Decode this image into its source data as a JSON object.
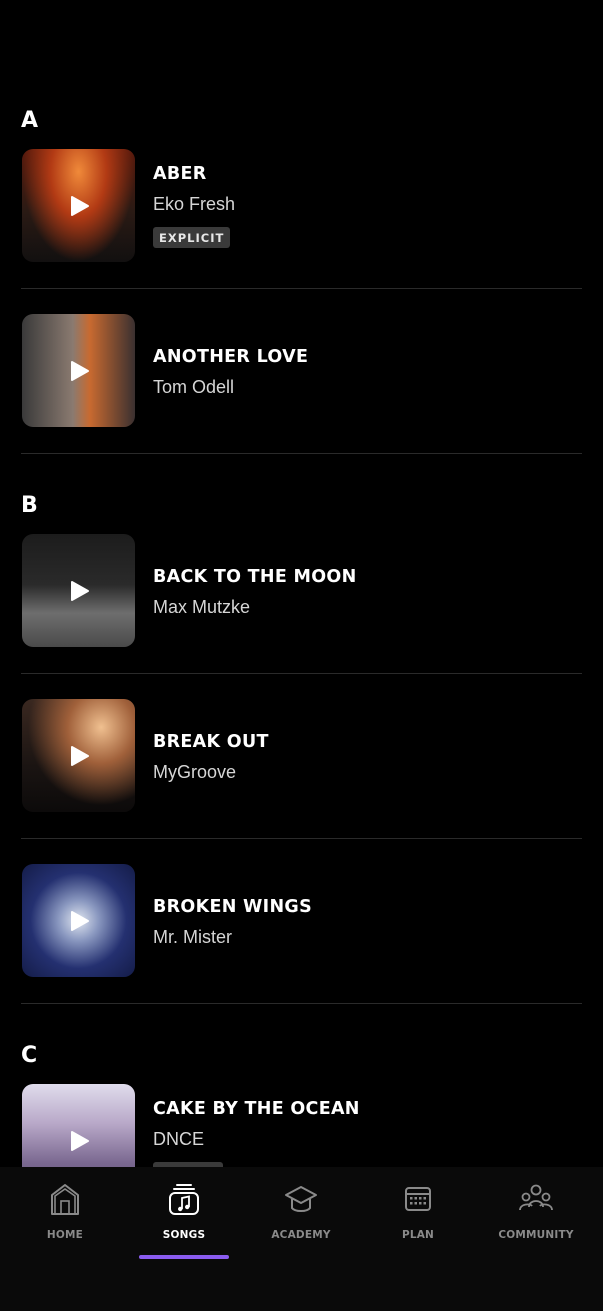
{
  "sections": [
    {
      "letter": "A"
    },
    {
      "letter": "B"
    },
    {
      "letter": "C"
    }
  ],
  "songs": [
    {
      "title": "ABER",
      "artist": "Eko Fresh",
      "badge": "EXPLICIT"
    },
    {
      "title": "ANOTHER LOVE",
      "artist": "Tom Odell"
    },
    {
      "title": "BACK TO THE MOON",
      "artist": "Max Mutzke"
    },
    {
      "title": "BREAK OUT",
      "artist": "MyGroove"
    },
    {
      "title": "BROKEN WINGS",
      "artist": "Mr. Mister"
    },
    {
      "title": "CAKE BY THE OCEAN",
      "artist": "DNCE"
    }
  ],
  "nav": {
    "home": "HOME",
    "songs": "SONGS",
    "academy": "ACADEMY",
    "plan": "PLAN",
    "community": "COMMUNITY",
    "active": "songs"
  },
  "colors": {
    "background": "#000000",
    "accent": "#8a5cf0",
    "badge_bg": "#3a3a3a",
    "inactive_nav": "#8a8a8a"
  }
}
